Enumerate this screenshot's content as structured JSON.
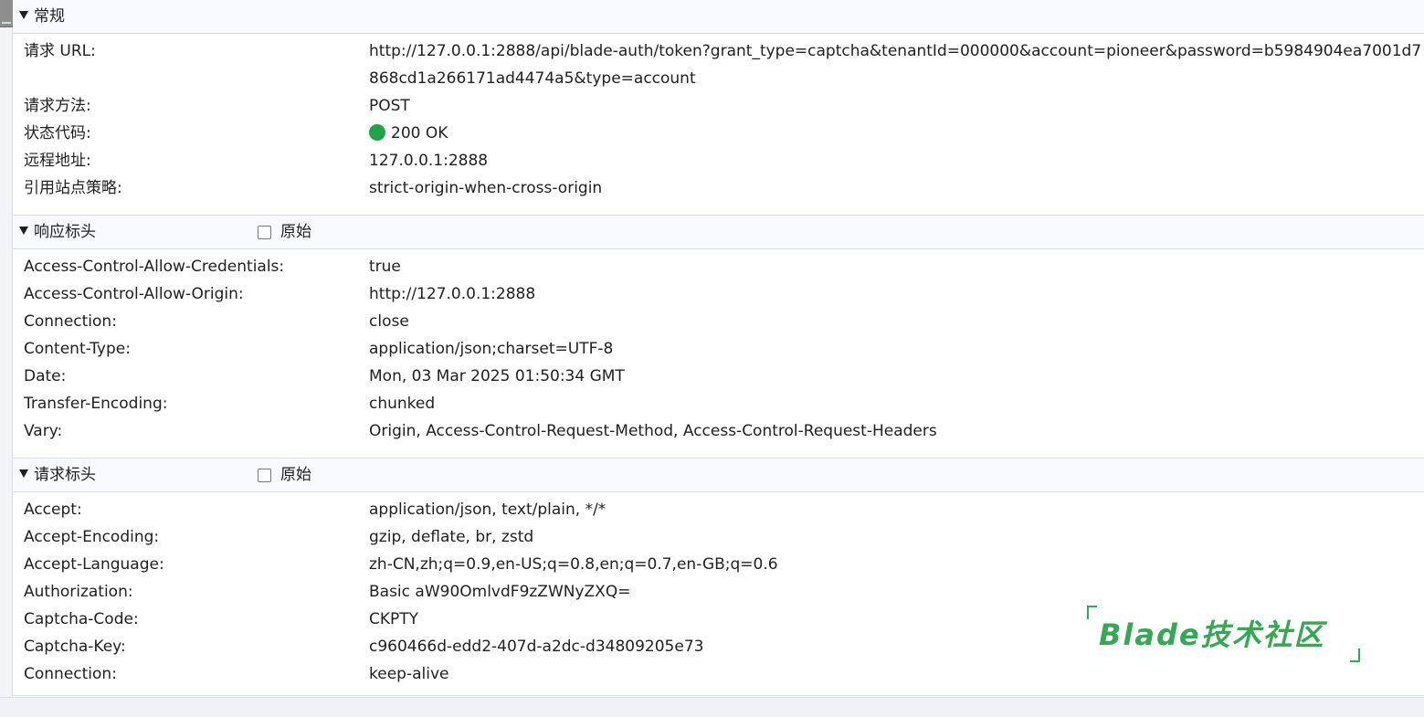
{
  "sections": {
    "general": {
      "title": "常规",
      "rows": [
        {
          "label": "请求 URL:",
          "value": "http://127.0.0.1:2888/api/blade-auth/token?grant_type=captcha&tenantId=000000&account=pioneer&password=b5984904ea7001d7868cd1a266171ad4474a5&type=account"
        },
        {
          "label": "请求方法:",
          "value": "POST"
        },
        {
          "label": "状态代码:",
          "value": "200 OK"
        },
        {
          "label": "远程地址:",
          "value": "127.0.0.1:2888"
        },
        {
          "label": "引用站点策略:",
          "value": "strict-origin-when-cross-origin"
        }
      ]
    },
    "response": {
      "title": "响应标头",
      "raw_label": "原始",
      "rows": [
        {
          "label": "Access-Control-Allow-Credentials:",
          "value": "true"
        },
        {
          "label": "Access-Control-Allow-Origin:",
          "value": "http://127.0.0.1:2888"
        },
        {
          "label": "Connection:",
          "value": "close"
        },
        {
          "label": "Content-Type:",
          "value": "application/json;charset=UTF-8"
        },
        {
          "label": "Date:",
          "value": "Mon, 03 Mar 2025 01:50:34 GMT"
        },
        {
          "label": "Transfer-Encoding:",
          "value": "chunked"
        },
        {
          "label": "Vary:",
          "value": "Origin, Access-Control-Request-Method, Access-Control-Request-Headers"
        }
      ]
    },
    "request": {
      "title": "请求标头",
      "raw_label": "原始",
      "rows": [
        {
          "label": "Accept:",
          "value": "application/json, text/plain, */*"
        },
        {
          "label": "Accept-Encoding:",
          "value": "gzip, deflate, br, zstd"
        },
        {
          "label": "Accept-Language:",
          "value": "zh-CN,zh;q=0.9,en-US;q=0.8,en;q=0.7,en-GB;q=0.6"
        },
        {
          "label": "Authorization:",
          "value": "Basic aW90OmlvdF9zZWNyZXQ="
        },
        {
          "label": "Captcha-Code:",
          "value": "CKPTY"
        },
        {
          "label": "Captcha-Key:",
          "value": "c960466d-edd2-407d-a2dc-d34809205e73"
        },
        {
          "label": "Connection:",
          "value": "keep-alive"
        }
      ]
    }
  },
  "watermark": {
    "text": "Blade技术社区",
    "color": "#34a853"
  },
  "status_dot_color": "#1fa34b"
}
